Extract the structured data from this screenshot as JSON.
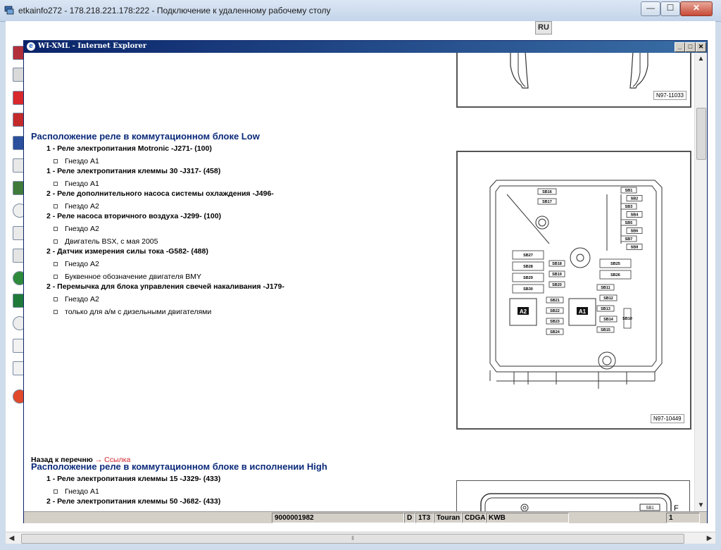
{
  "rdp_window": {
    "title": "etkainfo272 - 178.218.221.178:222 - Подключение к удаленному рабочему столу",
    "language_badge": "RU",
    "controls": {
      "minimize": "—",
      "maximize": "☐",
      "close": "✕"
    }
  },
  "ie_window": {
    "title": "WI-XML - Internet Explorer",
    "controls": {
      "minimize": "_",
      "maximize": "□",
      "close": "✕"
    }
  },
  "figures": {
    "top_label": "N97-11033",
    "fuse_box_label": "N97-10449",
    "fuse_labels": {
      "right_column": [
        "SB1",
        "SB2",
        "SB3",
        "SB4",
        "SB5",
        "SB6",
        "SB7",
        "SB8"
      ],
      "left_tall": [
        "SB27",
        "SB28",
        "SB29",
        "SB30"
      ],
      "center": [
        "SB16",
        "SB17",
        "SB18",
        "SB19",
        "SB20",
        "SB21",
        "SB22",
        "SB23",
        "SB24"
      ],
      "right_pair": [
        "SB25",
        "SB26"
      ],
      "right_small": [
        "SB11",
        "SB12",
        "SB13",
        "SB14",
        "SB15",
        "SB10"
      ],
      "relays": [
        "A2",
        "A1"
      ]
    }
  },
  "section_low": {
    "title": "Расположение реле в коммутационном блоке Low",
    "items": [
      {
        "label": "1 - Реле электропитания Motronic -J271- (100)",
        "subs": [
          "Гнездо A1"
        ]
      },
      {
        "label": "1 - Реле электропитания клеммы 30 -J317- (458)",
        "subs": [
          "Гнездо A1"
        ]
      },
      {
        "label": "2 - Реле дополнительного насоса системы охлаждения -J496-",
        "subs": [
          "Гнездо A2"
        ]
      },
      {
        "label": "2 - Реле насоса вторичного воздуха -J299- (100)",
        "subs": [
          "Гнездо A2",
          "Двигатель BSX, с мая 2005"
        ]
      },
      {
        "label": "2 - Датчик измерения силы тока -G582- (488)",
        "subs": [
          "Гнездо A2",
          "Буквенное обозначение двигателя BMY"
        ]
      },
      {
        "label": "2 - Перемычка для блока управления свечей накаливания -J179-",
        "subs": [
          "Гнездо A2",
          "только для а/м с дизельными двигателями"
        ]
      }
    ]
  },
  "back": {
    "text": "Назад к перечню",
    "arrow": "→",
    "link": "Ссылка"
  },
  "section_high": {
    "title": "Расположение реле в коммутационном блоке в исполнении High",
    "items": [
      {
        "label": "1 - Реле электропитания клеммы 15 -J329- (433)",
        "subs": [
          "Гнездо A1"
        ]
      },
      {
        "label": "2 - Реле электропитания клеммы 50 -J682- (433)",
        "subs": []
      }
    ],
    "partial_fig_label": "SB1",
    "partial_fig_letter": "F"
  },
  "status_bar": {
    "doc_number": "9000001982",
    "code": "D",
    "model_code": "1T3",
    "model_name": "Touran",
    "engine": "CDGA",
    "gearbox": "KWB",
    "page": "1"
  }
}
